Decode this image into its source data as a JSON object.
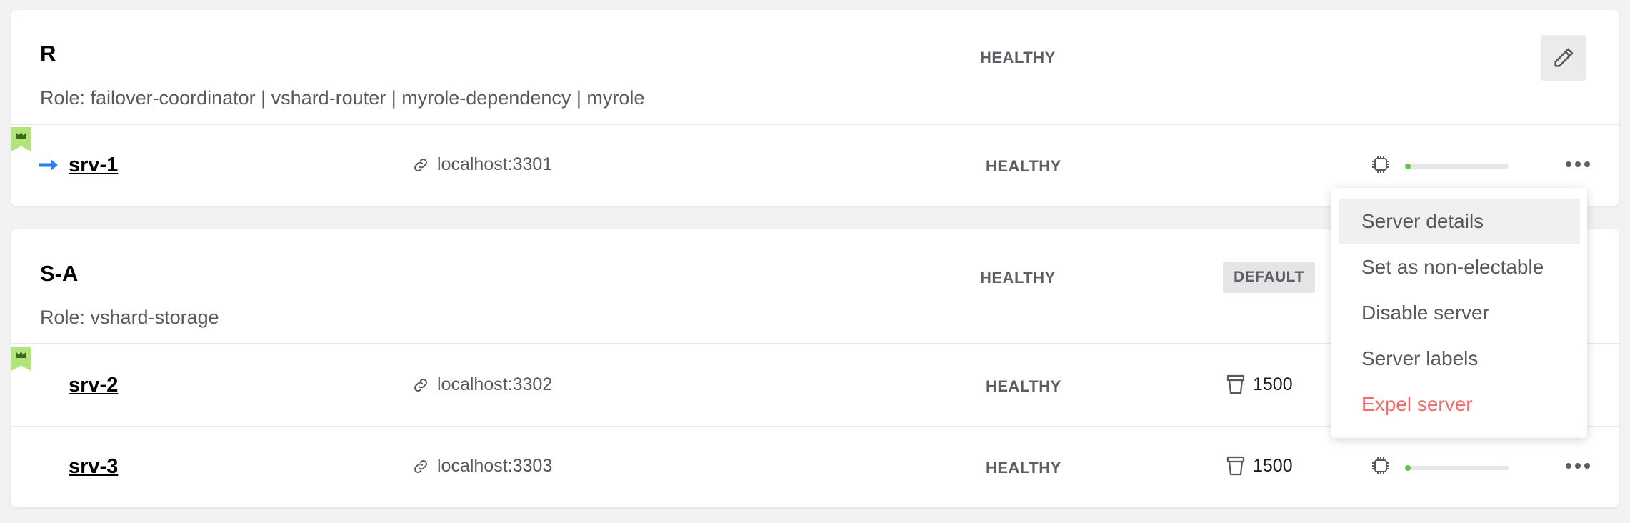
{
  "replicasets": [
    {
      "name": "R",
      "status": "HEALTHY",
      "roles": "Role: failover-coordinator | vshard-router | myrole-dependency | myrole",
      "servers": [
        {
          "name": "srv-1",
          "uri": "localhost:3301",
          "status": "HEALTHY",
          "leader": true,
          "memory_fraction": 0.03
        }
      ]
    },
    {
      "name": "S-A",
      "status": "HEALTHY",
      "roles": "Role: vshard-storage",
      "badge": "DEFAULT",
      "servers": [
        {
          "name": "srv-2",
          "uri": "localhost:3302",
          "status": "HEALTHY",
          "leader": true,
          "buckets": "1500"
        },
        {
          "name": "srv-3",
          "uri": "localhost:3303",
          "status": "HEALTHY",
          "leader": false,
          "buckets": "1500",
          "memory_fraction": 0.03
        }
      ]
    }
  ],
  "dropdown": {
    "items": [
      "Server details",
      "Set as non-electable",
      "Disable server",
      "Server labels",
      "Expel server"
    ]
  },
  "icons": {
    "edit": "pencil-icon",
    "uri": "link-icon",
    "leader": "crown-icon",
    "active": "arrow-right-icon",
    "bucket": "bucket-icon",
    "memory": "chip-icon",
    "menu": "more-horizontal-icon"
  },
  "colors": {
    "leader_flag": "#b3e37b",
    "arrow": "#2b7de9",
    "memory_fill": "#5bcb3c",
    "danger": "#ef6c6c"
  }
}
